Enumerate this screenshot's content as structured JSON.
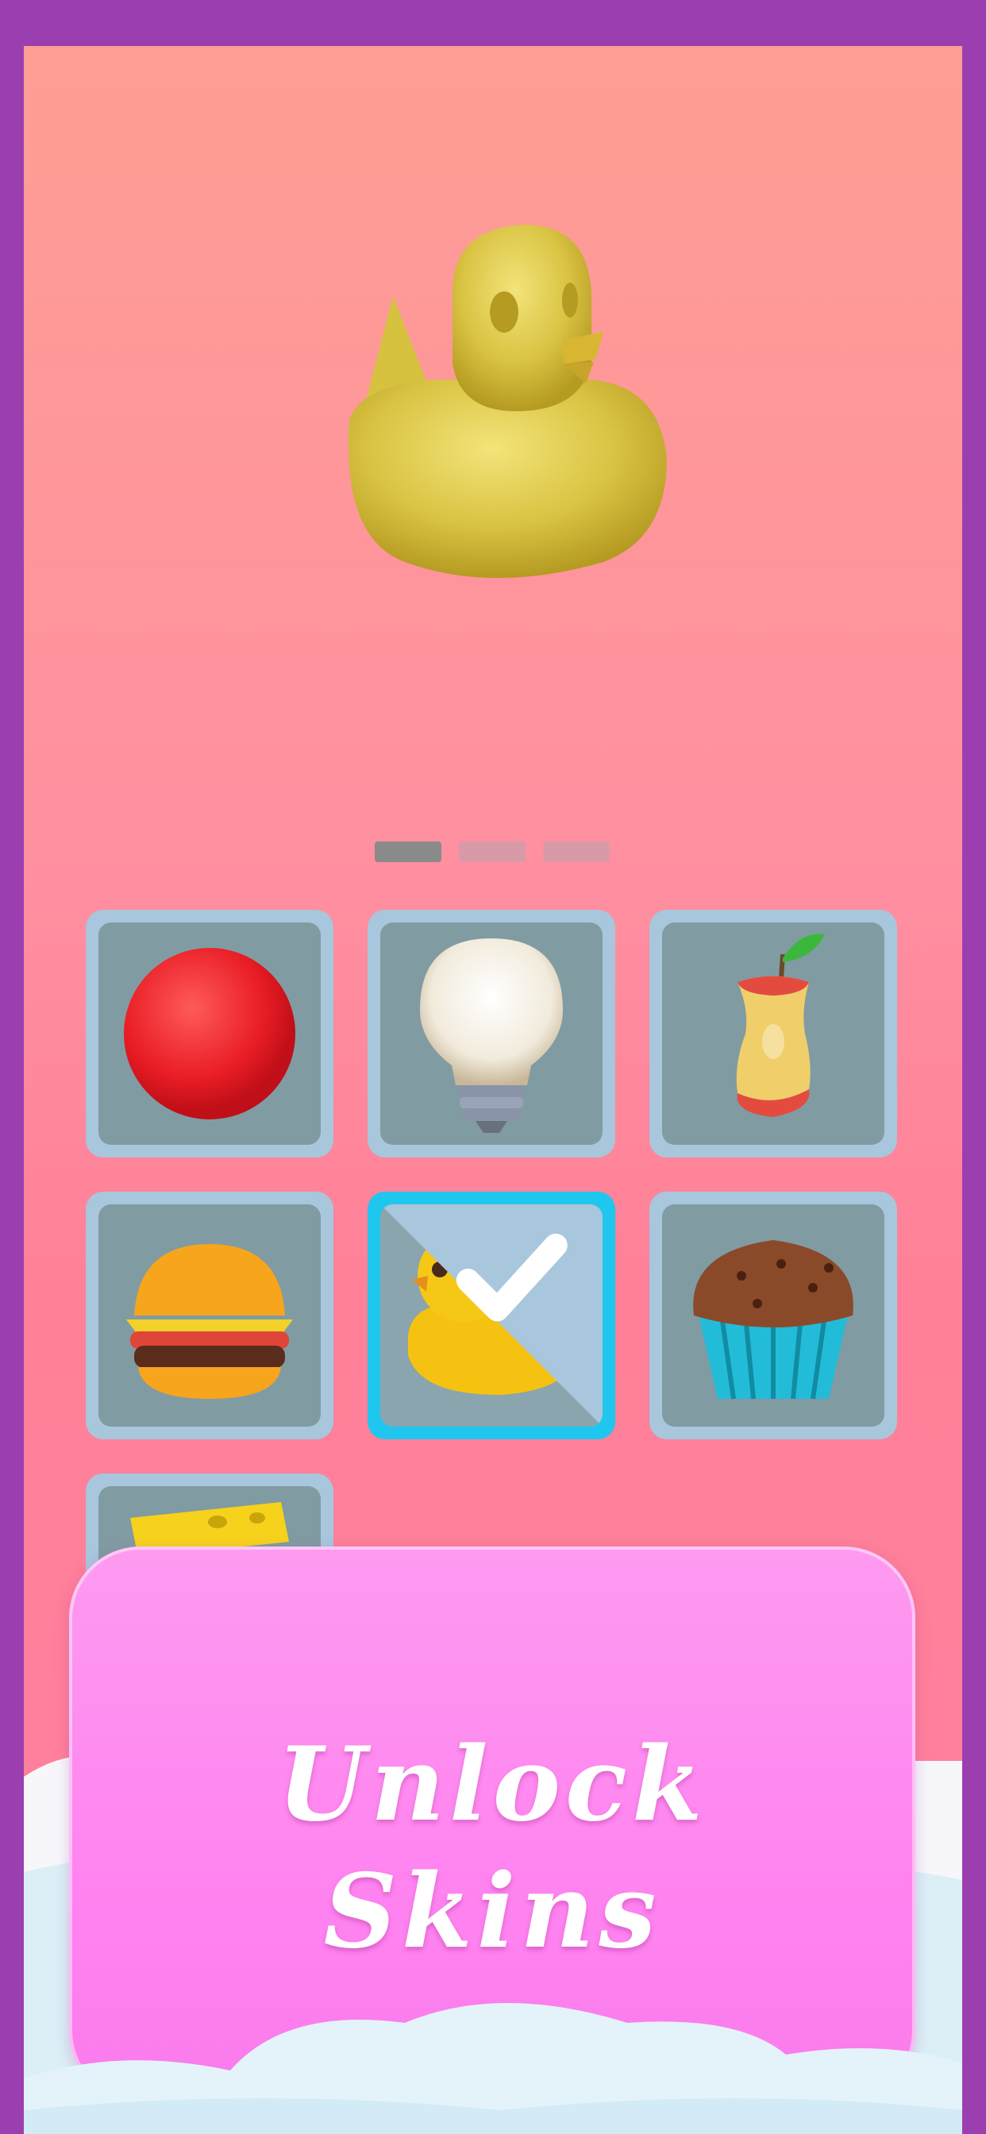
{
  "preview": {
    "skin": "rubber-duck"
  },
  "pager": {
    "count": 3,
    "active_index": 0
  },
  "skins": [
    {
      "name": "red-ball",
      "selected": false
    },
    {
      "name": "light-bulb",
      "selected": false
    },
    {
      "name": "apple-core",
      "selected": false
    },
    {
      "name": "burger",
      "selected": false
    },
    {
      "name": "rubber-duck",
      "selected": true
    },
    {
      "name": "muffin",
      "selected": false
    },
    {
      "name": "cheese",
      "selected": false
    }
  ],
  "unlock": {
    "label": "Unlock\nSkins"
  },
  "colors": {
    "frame": "#9b3fb0",
    "selected_border": "#1fc7ee",
    "button": "#ff84f0"
  }
}
